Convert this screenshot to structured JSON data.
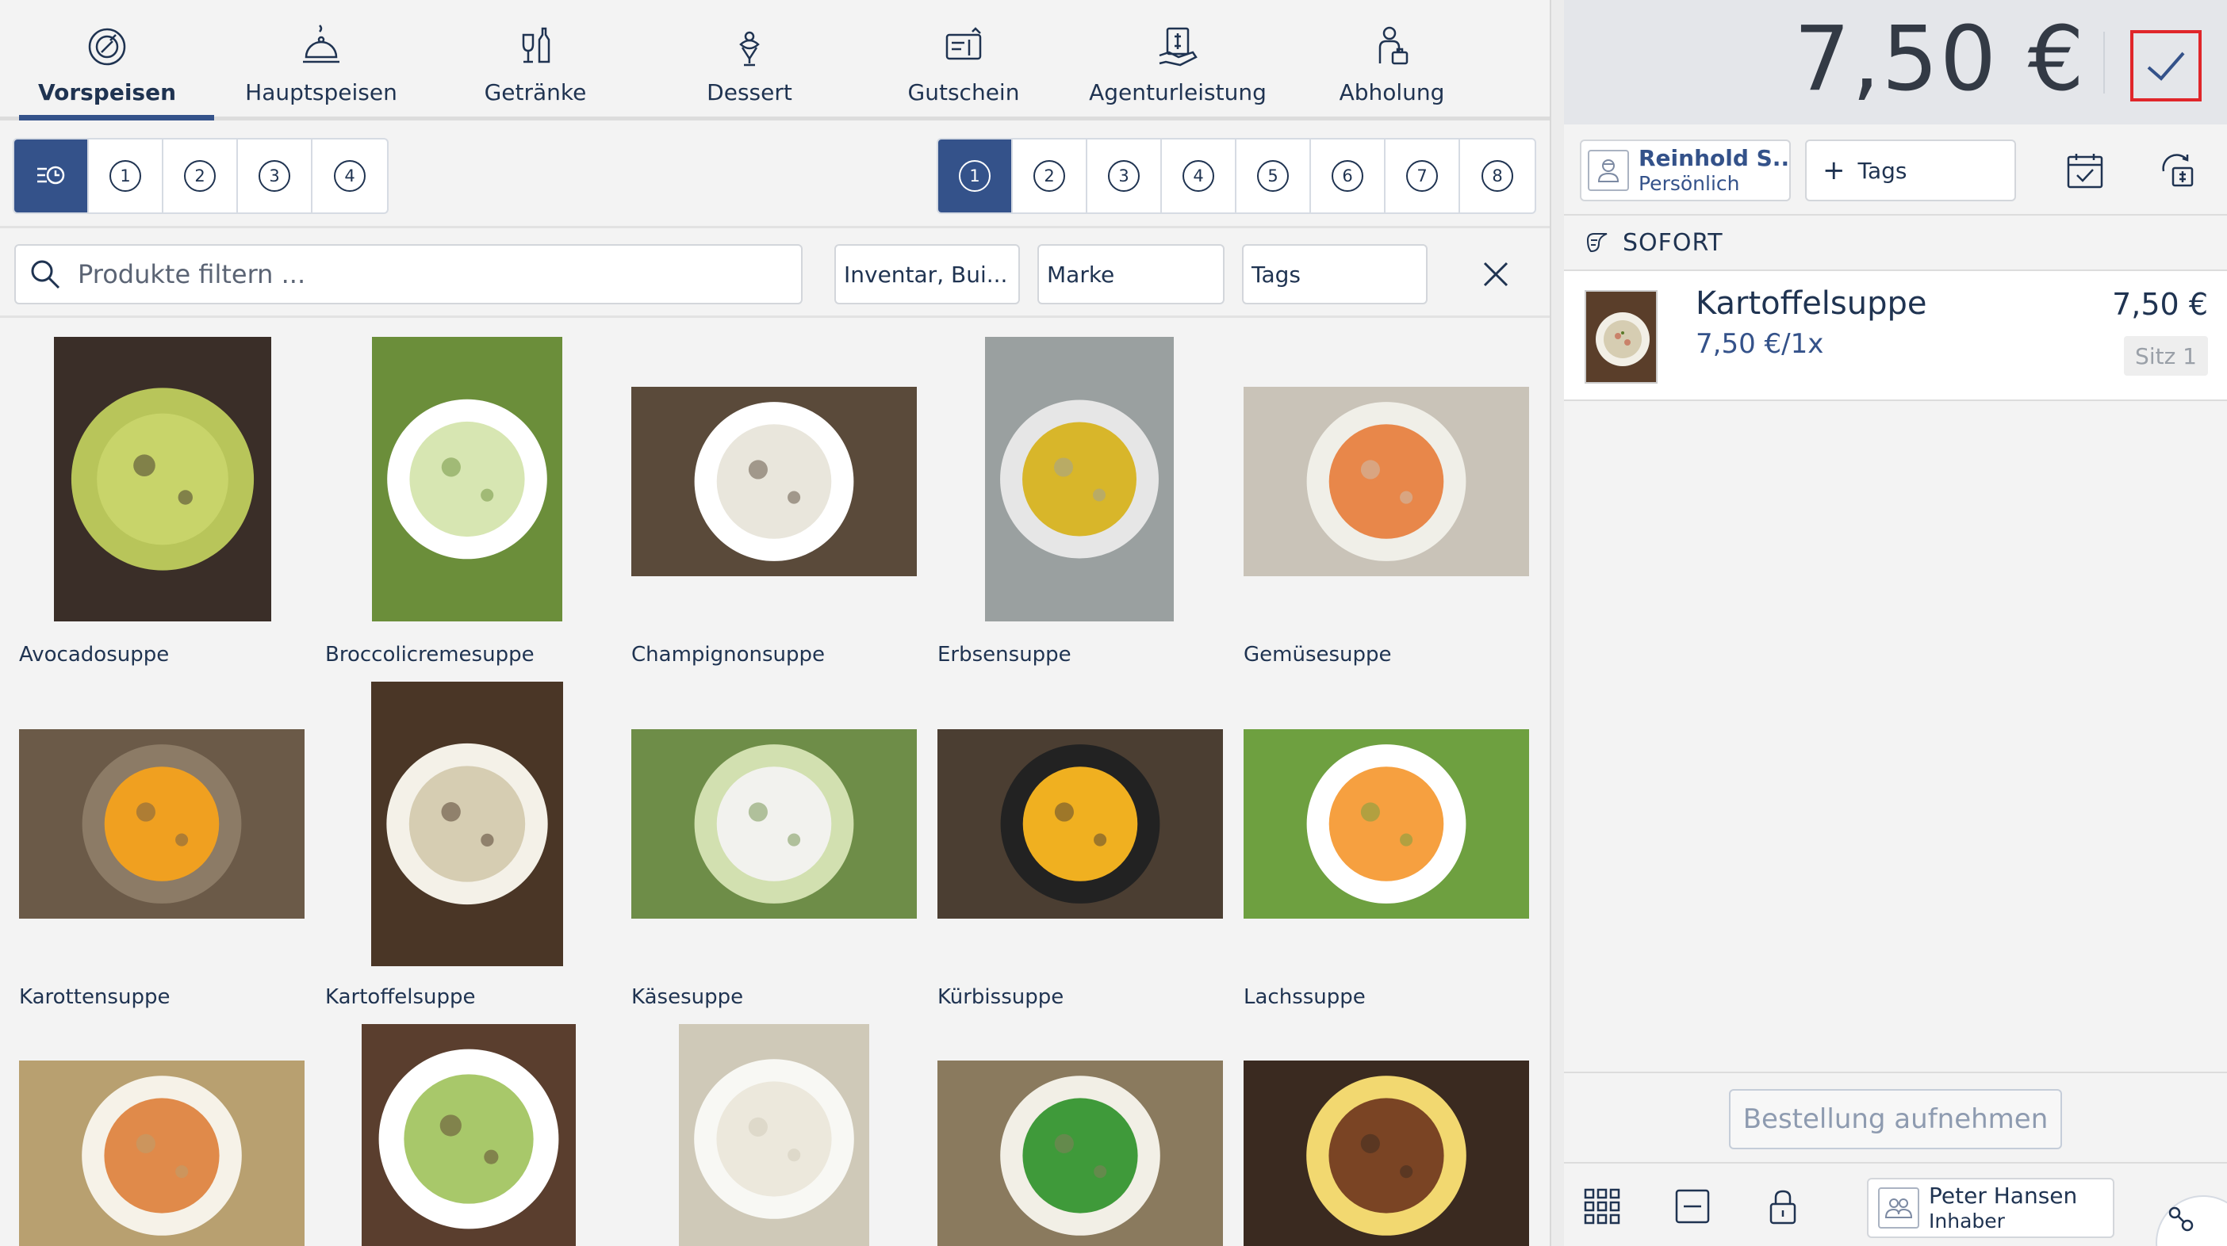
{
  "categories": [
    {
      "label": "Vorspeisen",
      "icon": "soup-bowl-icon",
      "active": true
    },
    {
      "label": "Hauptspeisen",
      "icon": "cloche-icon",
      "active": false
    },
    {
      "label": "Getränke",
      "icon": "drinks-icon",
      "active": false
    },
    {
      "label": "Dessert",
      "icon": "dessert-icon",
      "active": false
    },
    {
      "label": "Gutschein",
      "icon": "voucher-icon",
      "active": false
    },
    {
      "label": "Agenturleistung",
      "icon": "agency-service-icon",
      "active": false
    },
    {
      "label": "Abholung",
      "icon": "pickup-icon",
      "active": false
    }
  ],
  "course_selector": {
    "items": [
      "",
      "1",
      "2",
      "3",
      "4"
    ],
    "active_index": 0
  },
  "seat_selector": {
    "items": [
      "1",
      "2",
      "3",
      "4",
      "5",
      "6",
      "7",
      "8"
    ],
    "active_index": 0
  },
  "search": {
    "placeholder": "Produkte filtern ..."
  },
  "filters": {
    "inventory": "Inventar, Bui...",
    "brand": "Marke",
    "tags": "Tags"
  },
  "products": [
    {
      "name": "Avocadosuppe",
      "colors": [
        "#c8d46a",
        "#b8c55a",
        "#3a2e28"
      ]
    },
    {
      "name": "Broccolicremesuppe",
      "colors": [
        "#d7e6b2",
        "#ffffff",
        "#6b8e3a"
      ]
    },
    {
      "name": "Champignonsuppe",
      "colors": [
        "#e9e6dc",
        "#ffffff",
        "#5a4a3a"
      ]
    },
    {
      "name": "Erbsensuppe",
      "colors": [
        "#d8b62a",
        "#e6e6e6",
        "#9aa0a0"
      ]
    },
    {
      "name": "Gemüsesuppe",
      "colors": [
        "#e8874a",
        "#f0efe8",
        "#c9c3b8"
      ]
    },
    {
      "name": "Karottensuppe",
      "colors": [
        "#f0a020",
        "#8c7b66",
        "#6b5a48"
      ]
    },
    {
      "name": "Kartoffelsuppe",
      "colors": [
        "#d6cdb2",
        "#f4f1e8",
        "#4a3626"
      ]
    },
    {
      "name": "Käsesuppe",
      "colors": [
        "#f2f2ee",
        "#d2e0b0",
        "#6e8d48"
      ]
    },
    {
      "name": "Kürbissuppe",
      "colors": [
        "#f0b020",
        "#222222",
        "#4b3e32"
      ]
    },
    {
      "name": "Lachssuppe",
      "colors": [
        "#f6a040",
        "#ffffff",
        "#6ea040"
      ]
    },
    {
      "name": "",
      "colors": [
        "#e08a4a",
        "#f6f2e8",
        "#b8a070"
      ]
    },
    {
      "name": "",
      "colors": [
        "#a8c86a",
        "#ffffff",
        "#5a3e2e"
      ]
    },
    {
      "name": "",
      "colors": [
        "#ece8dc",
        "#f8f8f4",
        "#cfc9b8"
      ]
    },
    {
      "name": "",
      "colors": [
        "#3f9a3a",
        "#f2efe6",
        "#8a7a5e"
      ]
    },
    {
      "name": "",
      "colors": [
        "#7a4424",
        "#f2d870",
        "#3a2a20"
      ]
    }
  ],
  "order": {
    "total": "7,50 €",
    "customer_name": "Reinhold S...",
    "customer_type": "Persönlich",
    "tags_label": "Tags",
    "section_label": "SOFORT",
    "line": {
      "name": "Kartoffelsuppe",
      "unit": "7,50 €/1x",
      "price": "7,50 €",
      "seat": "Sitz 1"
    },
    "take_order_label": "Bestellung aufnehmen"
  },
  "staff": {
    "name": "Peter Hansen",
    "role": "Inhaber"
  },
  "colors": {
    "accent": "#34528a",
    "text": "#1f3351",
    "confirm_border": "#e0262a"
  }
}
